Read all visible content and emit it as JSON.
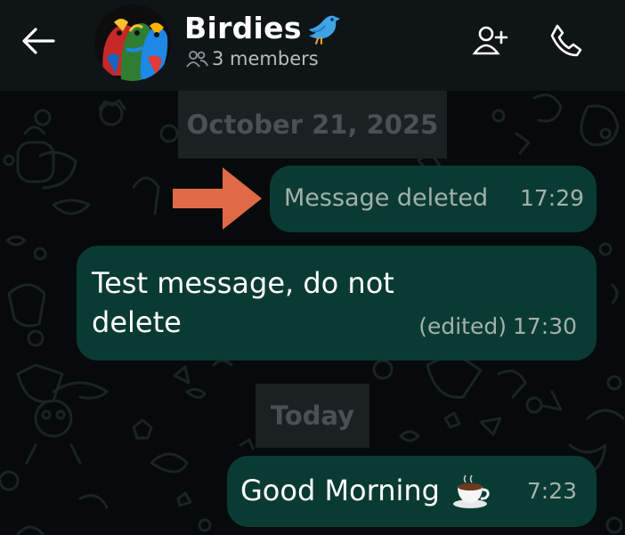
{
  "header": {
    "title": "Birdies",
    "members": "3 members",
    "back_icon": "arrow-left-icon",
    "add_member_icon": "add-user-icon",
    "call_icon": "phone-icon"
  },
  "messages": [
    {
      "type": "date",
      "label": "October 21, 2025"
    },
    {
      "type": "outgoing",
      "text": "Message deleted",
      "time": "17:29",
      "deleted": true
    },
    {
      "type": "outgoing",
      "text": "Test message, do not delete",
      "edited": "(edited)",
      "time": "17:30"
    },
    {
      "type": "date",
      "label": "Today"
    },
    {
      "type": "outgoing",
      "text": "Good Morning",
      "emoji": "coffee-cup-icon",
      "time": "7:23"
    }
  ],
  "annotation": {
    "icon": "orange-arrow-icon",
    "color": "#e06a46"
  },
  "colors": {
    "header_bg": "#0f1417",
    "bubble_bg": "#0a3b33",
    "chip_bg": "#1b2023",
    "chip_text": "#4a5155",
    "meta_text": "#a3b0ad"
  }
}
